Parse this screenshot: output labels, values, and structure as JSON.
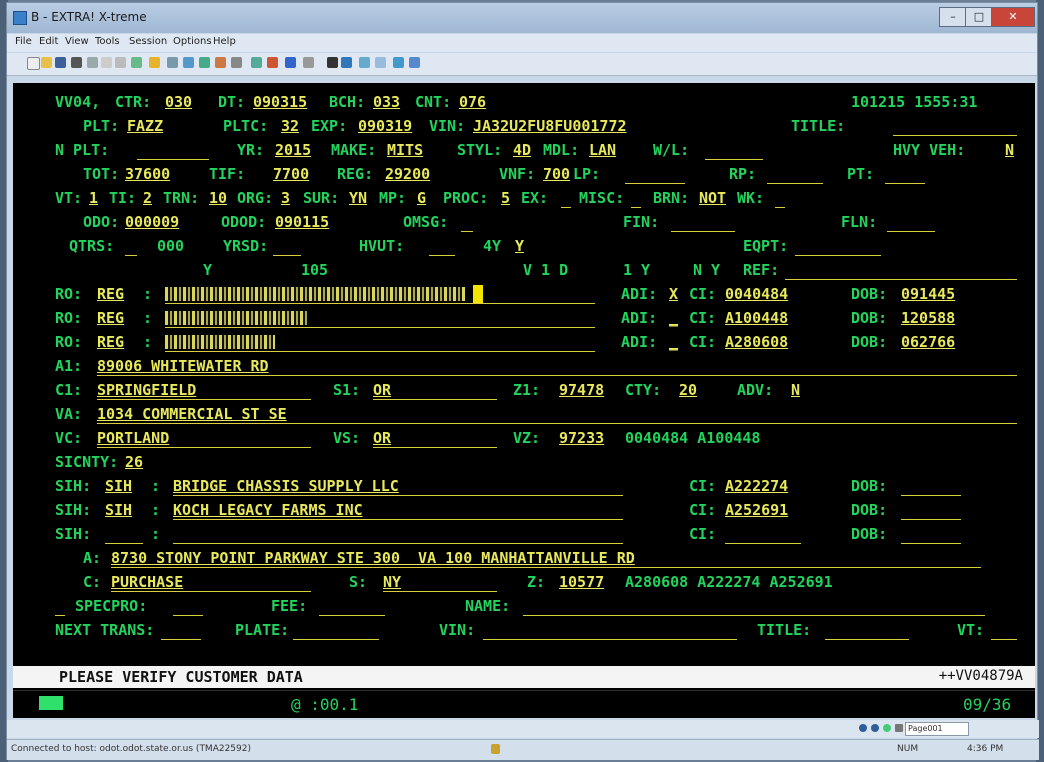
{
  "window": {
    "title": "B - EXTRA! X-treme"
  },
  "menu": [
    "File",
    "Edit",
    "View",
    "Tools",
    "Session",
    "Options",
    "Help"
  ],
  "terminal": {
    "header": {
      "screen": "VV04,",
      "ctr_label": "CTR:",
      "ctr": "030",
      "dt_label": "DT:",
      "dt": "090315",
      "bch_label": "BCH:",
      "bch": "033",
      "cnt_label": "CNT:",
      "cnt": "076",
      "datetime": "101215 1555:31"
    },
    "r2": {
      "plt_label": "PLT:",
      "plt": "FAZZ",
      "pltc_label": "PLTC:",
      "pltc": "32",
      "exp_label": "EXP:",
      "exp": "090319",
      "vin_label": "VIN:",
      "vin": "JA32U2FU8FU001772",
      "title_label": "TITLE:"
    },
    "r3": {
      "nplt_label": "N PLT:",
      "yr_label": "YR:",
      "yr": "2015",
      "make_label": "MAKE:",
      "make": "MITS",
      "styl_label": "STYL:",
      "styl": "4D",
      "mdl_label": "MDL:",
      "mdl": "LAN",
      "wl_label": "W/L:",
      "hvy_label": "HVY VEH:",
      "hvy": "N"
    },
    "r4": {
      "tot_label": "TOT:",
      "tot": "37600",
      "tif_label": "TIF:",
      "tif": "7700",
      "reg_label": "REG:",
      "reg": "29200",
      "vnf_label": "VNF:",
      "vnf": "700",
      "lp_label": "LP:",
      "rp_label": "RP:",
      "pt_label": "PT:"
    },
    "r5": {
      "vt_label": "VT:",
      "vt": "1",
      "ti_label": "TI:",
      "ti": "2",
      "trn_label": "TRN:",
      "trn": "10",
      "org_label": "ORG:",
      "org": "3",
      "sur_label": "SUR:",
      "sur": "YN",
      "mp_label": "MP:",
      "mp": "G",
      "proc_label": "PROC:",
      "proc": "5",
      "ex_label": "EX:",
      "misc_label": "MISC:",
      "brn_label": "BRN:",
      "brn": "NOT",
      "wk_label": "WK:"
    },
    "r6": {
      "odo_label": "ODO:",
      "odo": "000009",
      "odod_label": "ODOD:",
      "odod": "090115",
      "omsg_label": "OMSG:",
      "fin_label": "FIN:",
      "fln_label": "FLN:"
    },
    "r7": {
      "qtrs_label": "QTRS:",
      "qtrs": "000",
      "yrsd_label": "YRSD:",
      "hvut_label": "HVUT:",
      "hvut": "4Y",
      "hvut2": "Y",
      "eqpt_label": "EQPT:"
    },
    "r8": {
      "a": "Y",
      "b": "105",
      "c": "V 1 D",
      "d": "1 Y",
      "e": "N Y",
      "ref_label": "REF:"
    },
    "owners": [
      {
        "ro_label": "RO:",
        "ro": "REG",
        "adi_label": "ADI:",
        "adi": "X",
        "ci_label": "CI:",
        "ci": "0040484",
        "dob_label": "DOB:",
        "dob": "091445"
      },
      {
        "ro_label": "RO:",
        "ro": "REG",
        "adi_label": "ADI:",
        "adi": "_",
        "ci_label": "CI:",
        "ci": "A100448",
        "dob_label": "DOB:",
        "dob": "120588"
      },
      {
        "ro_label": "RO:",
        "ro": "REG",
        "adi_label": "ADI:",
        "adi": "_",
        "ci_label": "CI:",
        "ci": "A280608",
        "dob_label": "DOB:",
        "dob": "062766"
      }
    ],
    "a1": {
      "label": "A1:",
      "value": "89006 WHITEWATER RD"
    },
    "c1": {
      "label": "C1:",
      "value": "SPRINGFIELD",
      "s1_label": "S1:",
      "s1": "OR",
      "z1_label": "Z1:",
      "z1": "97478",
      "cty_label": "CTY:",
      "cty": "20",
      "adv_label": "ADV:",
      "adv": "N"
    },
    "va": {
      "label": "VA:",
      "value": "1034 COMMERCIAL ST SE"
    },
    "vc": {
      "label": "VC:",
      "value": "PORTLAND",
      "vs_label": "VS:",
      "vs": "OR",
      "vz_label": "VZ:",
      "vz": "97233",
      "ids": "0040484 A100448"
    },
    "sicnty": {
      "label": "SICNTY:",
      "value": "26"
    },
    "sih": [
      {
        "label": "SIH:",
        "code": "SIH",
        "name": "BRIDGE CHASSIS SUPPLY LLC",
        "ci_label": "CI:",
        "ci": "A222274",
        "dob_label": "DOB:"
      },
      {
        "label": "SIH:",
        "code": "SIH",
        "name": "KOCH LEGACY FARMS INC",
        "ci_label": "CI:",
        "ci": "A252691",
        "dob_label": "DOB:"
      },
      {
        "label": "SIH:",
        "code": "",
        "name": "",
        "ci_label": "CI:",
        "ci": "",
        "dob_label": "DOB:"
      }
    ],
    "a": {
      "label": "A:",
      "value": "8730 STONY POINT PARKWAY STE 300  VA 100 MANHATTANVILLE RD"
    },
    "c": {
      "label": "C:",
      "value": "PURCHASE",
      "s_label": "S:",
      "s": "NY",
      "z_label": "Z:",
      "z": "10577",
      "ids": "A280608 A222274 A252691"
    },
    "spec": {
      "specpro_label": "SPECPRO:",
      "fee_label": "FEE:",
      "name_label": "NAME:"
    },
    "next": {
      "label": "NEXT TRANS:",
      "plate_label": "PLATE:",
      "vin_label": "VIN:",
      "title_label": "TITLE:",
      "vt_label": "VT:"
    },
    "message": "PLEASE VERIFY CUSTOMER DATA",
    "message_id": "++VV04879A",
    "oia": {
      "timer": "@ :00.1",
      "cursor_pos": "09/36"
    }
  },
  "status": {
    "connection": "Connected to host: odot.odot.state.or.us (TMA22592)",
    "num": "NUM",
    "time": "4:36 PM",
    "page_box": "Page001"
  },
  "colors": {
    "field_label": "#23d35e",
    "field_value": "#e8e85c",
    "terminal_bg": "#000000"
  }
}
